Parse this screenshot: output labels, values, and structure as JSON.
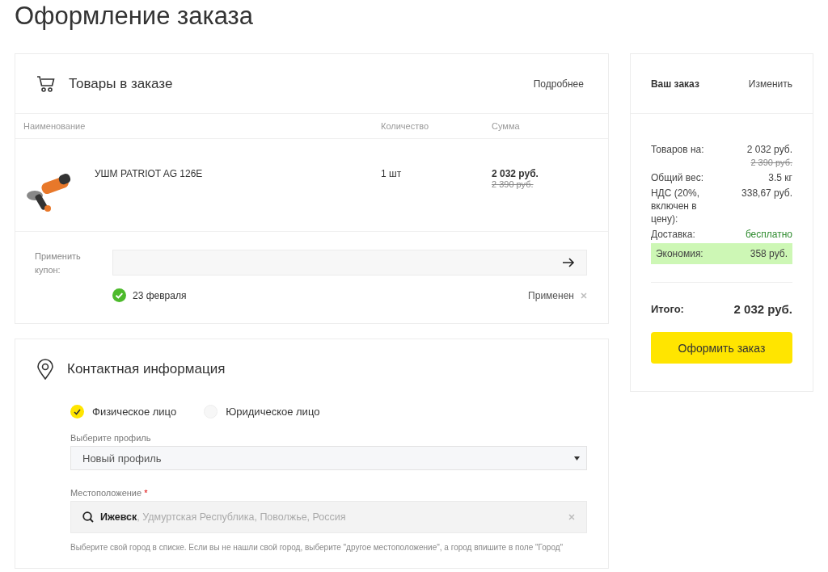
{
  "page_title": "Оформление заказа",
  "products": {
    "title": "Товары в заказе",
    "details_link": "Подробнее",
    "columns": [
      "Наименование",
      "Количество",
      "Сумма"
    ],
    "rows": [
      {
        "name": "УШМ PATRIOT AG 126E",
        "quantity": "1 шт",
        "price": "2 032 руб.",
        "old_price": "2 390 руб."
      }
    ],
    "coupon": {
      "label": "Применить купон:",
      "applied": [
        {
          "code": "23 февраля",
          "status": "Применен"
        }
      ]
    }
  },
  "contact": {
    "title": "Контактная информация",
    "person_types": [
      {
        "label": "Физическое лицо",
        "selected": true
      },
      {
        "label": "Юридическое лицо",
        "selected": false
      }
    ],
    "profile": {
      "label": "Выберите профиль",
      "value": "Новый профиль"
    },
    "location": {
      "label": "Местоположение",
      "required_mark": "*",
      "value": "**Ижевск**, Удмуртская Республика, Поволжье, Россия",
      "hint": "Выберите свой город в списке. Если вы не нашли свой город, выберите \"другое местоположение\", а город впишите в поле \"Город\""
    }
  },
  "summary": {
    "title": "Ваш заказ",
    "edit_link": "Изменить",
    "rows": [
      {
        "kind": "plain",
        "label": "Товаров на:",
        "value": "2 032 руб.",
        "old_value": "2 390 руб."
      },
      {
        "kind": "plain",
        "label": "Общий вес:",
        "value": "3.5 кг"
      },
      {
        "kind": "plain",
        "label": "НДС (20%, включен в цену):",
        "value": "338,67 руб."
      },
      {
        "kind": "free",
        "label": "Доставка:",
        "value": "бесплатно"
      },
      {
        "kind": "savings",
        "label": "Экономия:",
        "value": "358 руб."
      }
    ],
    "total_label": "Итого:",
    "total_value": "2 032 руб.",
    "submit": "Оформить заказ"
  }
}
